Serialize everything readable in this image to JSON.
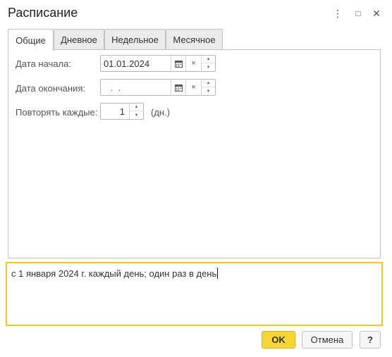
{
  "window": {
    "title": "Расписание",
    "more_icon": "⋮",
    "maximize_icon": "□",
    "close_icon": "✕"
  },
  "tabs": [
    {
      "label": "Общие",
      "active": true
    },
    {
      "label": "Дневное",
      "active": false
    },
    {
      "label": "Недельное",
      "active": false
    },
    {
      "label": "Месячное",
      "active": false
    }
  ],
  "general": {
    "start_date": {
      "label": "Дата начала:",
      "value": "01.01.2024"
    },
    "end_date": {
      "label": "Дата окончания:",
      "value": " .  ."
    },
    "repeat": {
      "label": "Повторять каждые:",
      "value": "1",
      "unit": "(дн.)"
    }
  },
  "icons": {
    "calendar": "calendar-icon",
    "clear": "×",
    "spin_up": "▲",
    "spin_down": "▼"
  },
  "description": "с 1 января 2024 г. каждый день; один раз в день",
  "buttons": {
    "ok": "OK",
    "cancel": "Отмена",
    "help": "?"
  },
  "colors": {
    "accent_border": "#f5c622",
    "ok_button": "#f7d634"
  }
}
